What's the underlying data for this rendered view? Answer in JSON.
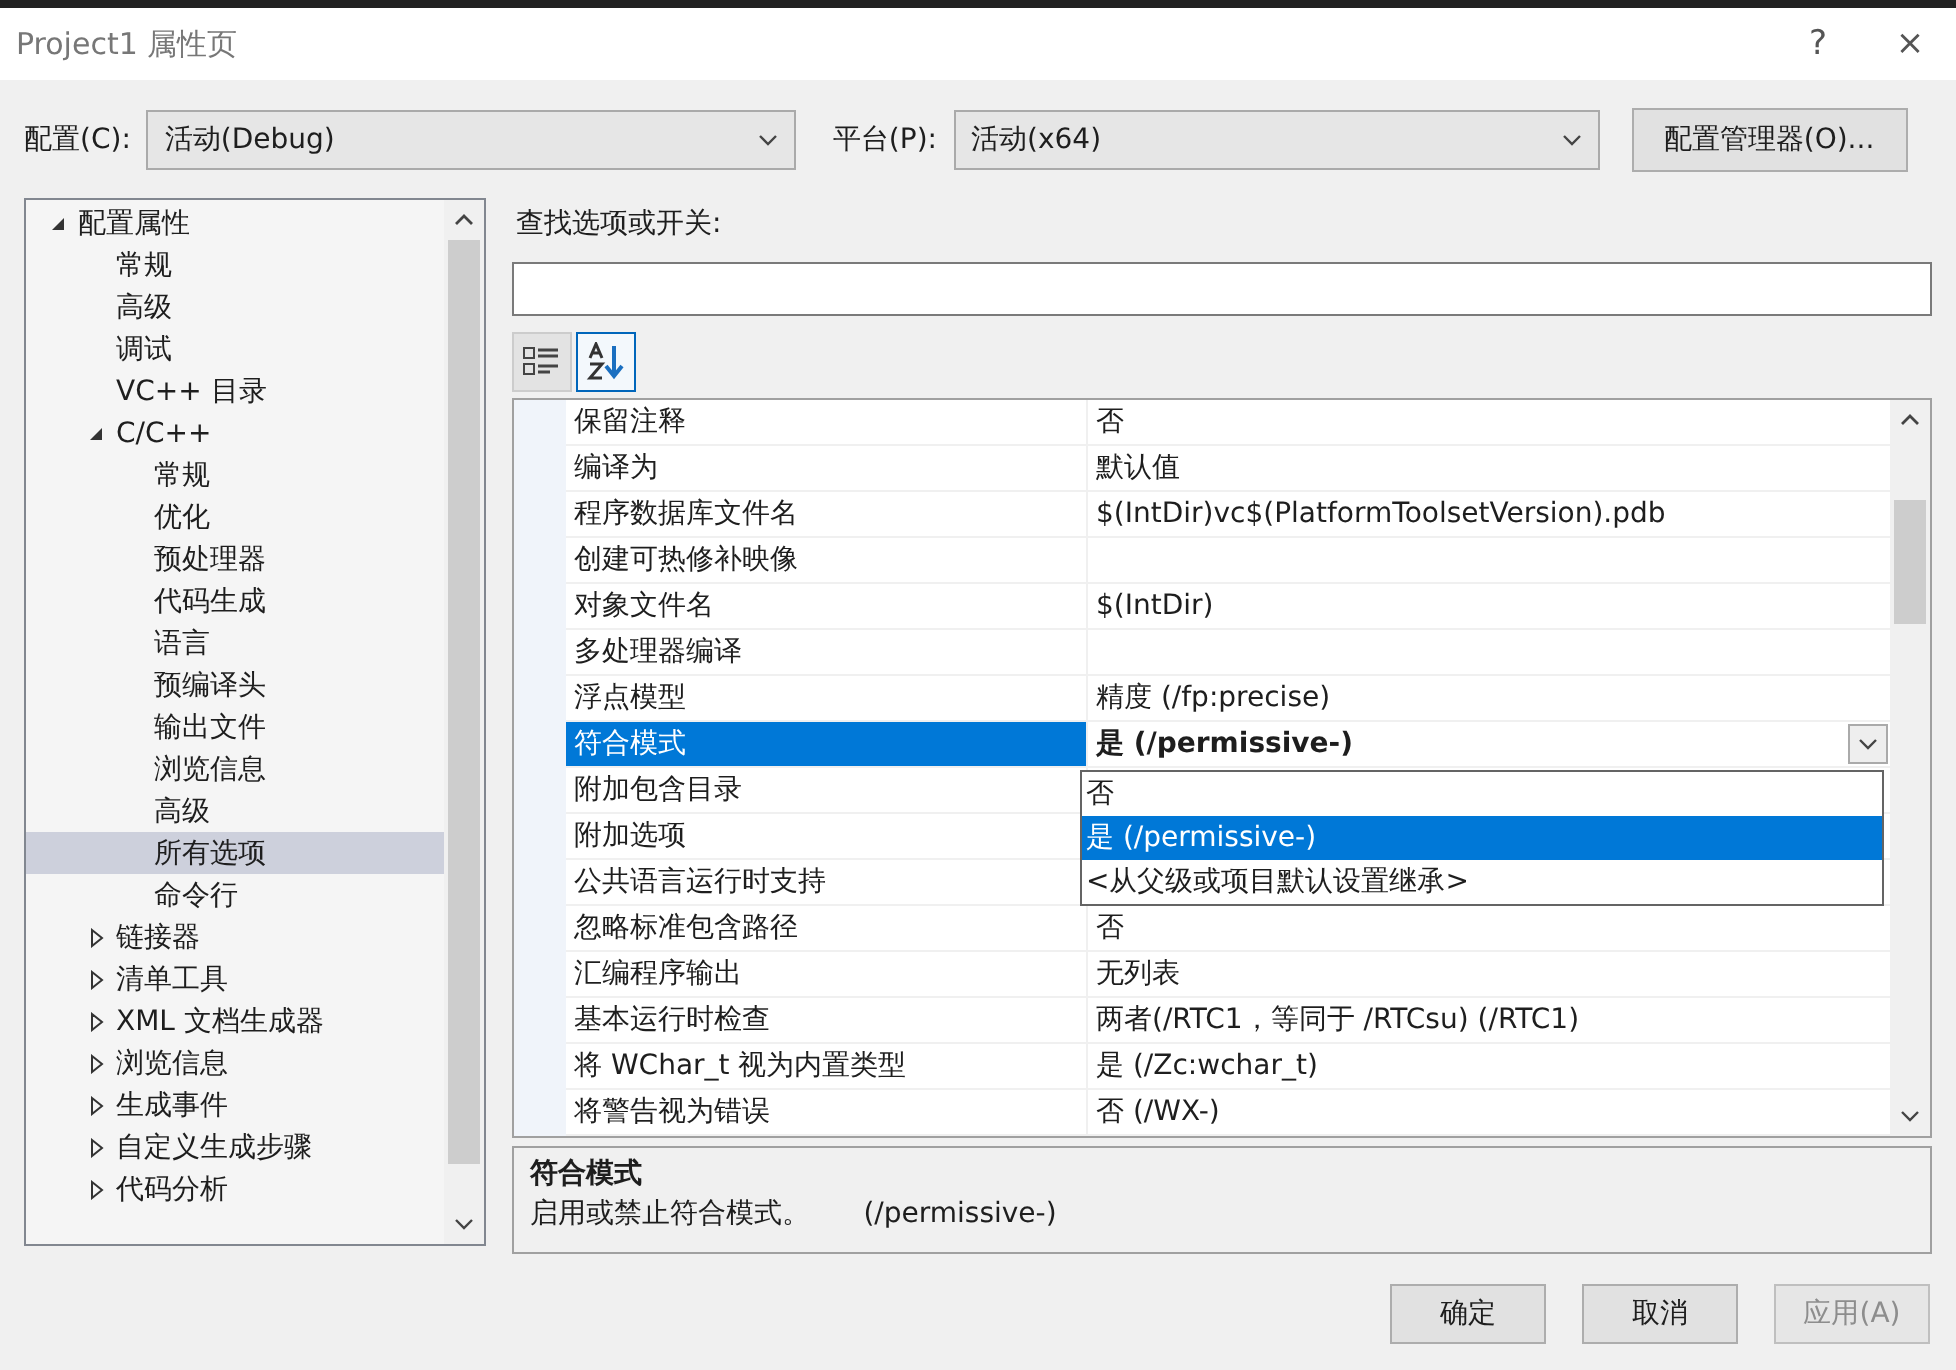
{
  "window": {
    "title": "Project1 属性页",
    "help": "?",
    "close": "×"
  },
  "config": {
    "label": "配置(C):",
    "value": "活动(Debug)"
  },
  "platform": {
    "label": "平台(P):",
    "value": "活动(x64)"
  },
  "config_manager": "配置管理器(O)...",
  "tree": [
    {
      "label": "配置属性",
      "expanded": true,
      "selected": false,
      "children": [
        {
          "label": "常规",
          "selected": false
        },
        {
          "label": "高级",
          "selected": false
        },
        {
          "label": "调试",
          "selected": false
        },
        {
          "label": "VC++ 目录",
          "selected": false
        },
        {
          "label": "C/C++",
          "expanded": true,
          "selected": false,
          "children": [
            {
              "label": "常规",
              "selected": false
            },
            {
              "label": "优化",
              "selected": false
            },
            {
              "label": "预处理器",
              "selected": false
            },
            {
              "label": "代码生成",
              "selected": false
            },
            {
              "label": "语言",
              "selected": false
            },
            {
              "label": "预编译头",
              "selected": false
            },
            {
              "label": "输出文件",
              "selected": false
            },
            {
              "label": "浏览信息",
              "selected": false
            },
            {
              "label": "高级",
              "selected": false
            },
            {
              "label": "所有选项",
              "selected": true
            },
            {
              "label": "命令行",
              "selected": false
            }
          ]
        },
        {
          "label": "链接器",
          "expanded": false,
          "selected": false
        },
        {
          "label": "清单工具",
          "expanded": false,
          "selected": false
        },
        {
          "label": "XML 文档生成器",
          "expanded": false,
          "selected": false
        },
        {
          "label": "浏览信息",
          "expanded": false,
          "selected": false
        },
        {
          "label": "生成事件",
          "expanded": false,
          "selected": false
        },
        {
          "label": "自定义生成步骤",
          "expanded": false,
          "selected": false
        },
        {
          "label": "代码分析",
          "expanded": false,
          "selected": false
        }
      ]
    }
  ],
  "search": {
    "label": "查找选项或开关:"
  },
  "toolbar": [
    {
      "kind": "categorized",
      "selected": false
    },
    {
      "kind": "alphabetical",
      "selected": true
    }
  ],
  "grid": {
    "rows": [
      {
        "name": "保留注释",
        "value": "否",
        "selected": false
      },
      {
        "name": "编译为",
        "value": "默认值",
        "selected": false
      },
      {
        "name": "程序数据库文件名",
        "value": "$(IntDir)vc$(PlatformToolsetVersion).pdb",
        "selected": false
      },
      {
        "name": "创建可热修补映像",
        "selected": false
      },
      {
        "name": "对象文件名",
        "value": "$(IntDir)",
        "selected": false
      },
      {
        "name": "多处理器编译",
        "selected": false
      },
      {
        "name": "浮点模型",
        "value": "精度 (/fp:precise)",
        "selected": false
      },
      {
        "name": "符合模式",
        "value": "是 (/permissive-)",
        "selected": true
      },
      {
        "name": "附加包含目录",
        "selected": false
      },
      {
        "name": "附加选项",
        "selected": false
      },
      {
        "name": "公共语言运行时支持",
        "selected": false
      },
      {
        "name": "忽略标准包含路径",
        "value": "否",
        "selected": false
      },
      {
        "name": "汇编程序输出",
        "value": "无列表",
        "selected": false
      },
      {
        "name": "基本运行时检查",
        "value": "两者(/RTC1，等同于 /RTCsu) (/RTC1)",
        "selected": false
      },
      {
        "name": "将 WChar_t 视为内置类型",
        "value": "是 (/Zc:wchar_t)",
        "selected": false
      },
      {
        "name": "将警告视为错误",
        "value": "否 (/WX-)",
        "selected": false
      }
    ],
    "dropdown": [
      {
        "label": "否",
        "selected": false
      },
      {
        "label": "是 (/permissive-)",
        "selected": true
      },
      {
        "label": "<从父级或项目默认设置继承>",
        "selected": false
      }
    ]
  },
  "description": {
    "title": "符合模式",
    "text": "启用或禁止符合模式。      (/permissive-)"
  },
  "buttons": [
    {
      "label": "确定",
      "disabled": false
    },
    {
      "label": "取消",
      "disabled": false
    },
    {
      "label": "应用(A)",
      "disabled": true
    }
  ]
}
